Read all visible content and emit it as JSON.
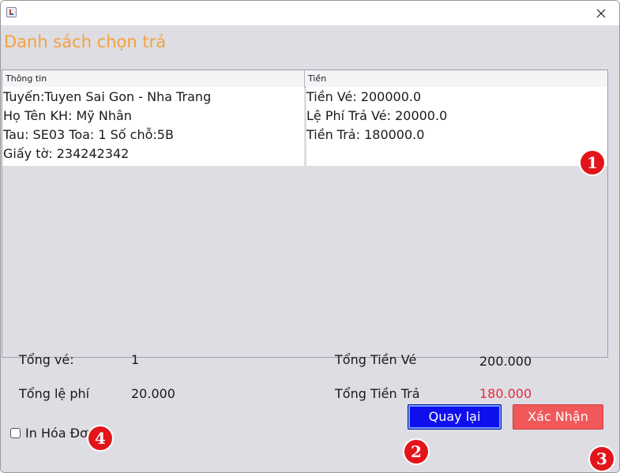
{
  "window": {
    "title": ""
  },
  "page": {
    "title": "Danh sách chọn trả"
  },
  "table": {
    "headers": [
      "Thông tin",
      "Tiền"
    ],
    "row": {
      "info": [
        "Tuyến:Tuyen Sai Gon - Nha Trang",
        "Họ Tên KH: Mỹ Nhân",
        "Tau: SE03 Toa: 1 Số chỗ:5B",
        "Giấy tờ: 234242342"
      ],
      "money": [
        "Tiền Vé: 200000.0",
        "Lệ Phí Trả Vé: 20000.0",
        "Tiền Trả: 180000.0"
      ]
    }
  },
  "summary": {
    "total_tickets_label": "Tổng vé:",
    "total_tickets_value": "1",
    "total_fee_label": "Tổng lệ phí",
    "total_fee_value": "20.000",
    "total_ticket_money_label": "Tổng Tiền Vé",
    "total_ticket_money_value": "200.000",
    "total_refund_label": "Tổng Tiền Trả",
    "total_refund_value": "180.000"
  },
  "print_invoice": {
    "label": "In Hóa Đơn",
    "checked": false
  },
  "buttons": {
    "back": "Quay lại",
    "confirm": "Xác Nhận"
  },
  "markers": [
    "1",
    "2",
    "3",
    "4"
  ],
  "colors": {
    "title": "#f4a23e",
    "refund_value": "#e8283b",
    "back_button": "#1010ee",
    "confirm_button": "#f0585a",
    "marker": "#e2151b"
  },
  "icons": {
    "window": "java-app-icon",
    "close": "close-icon",
    "checkbox": "checkbox-unchecked-icon"
  }
}
